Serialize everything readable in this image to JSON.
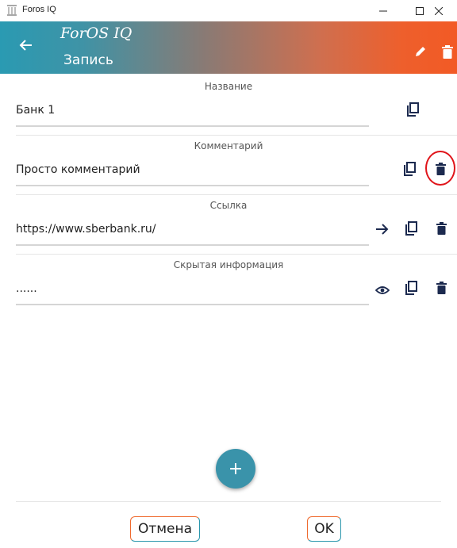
{
  "window": {
    "title": "Foros IQ"
  },
  "appbar": {
    "logo": "ForOS IQ",
    "subtitle": "Запись"
  },
  "fields": [
    {
      "label": "Название",
      "value": "Банк 1"
    },
    {
      "label": "Комментарий",
      "value": "Просто комментарий"
    },
    {
      "label": "Ссылка",
      "value": "https://www.sberbank.ru/"
    },
    {
      "label": "Скрытая информация",
      "value": "......"
    }
  ],
  "fab": {
    "label": "+"
  },
  "footer": {
    "cancel_label": "Отмена",
    "ok_label": "OK"
  },
  "colors": {
    "accent_teal": "#2a9ab2",
    "accent_orange": "#f25a25",
    "icon_dark": "#1c2a4f",
    "annotation_red": "#e0141a"
  }
}
